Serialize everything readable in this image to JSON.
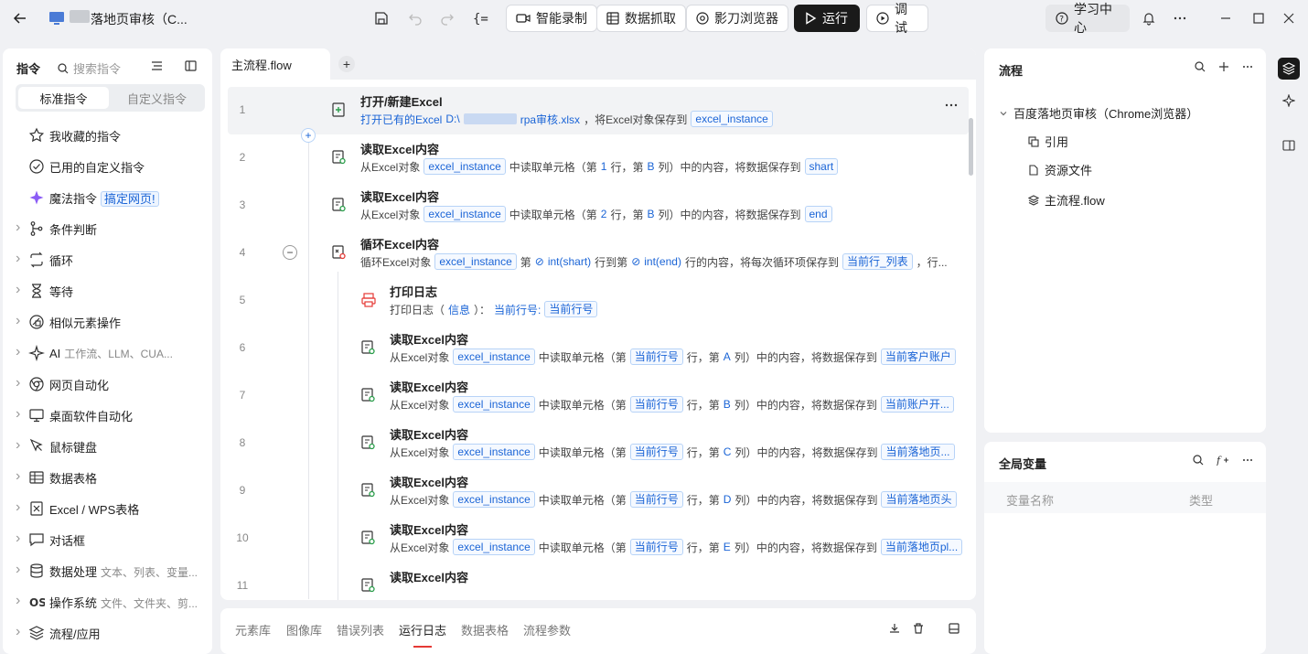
{
  "app": {
    "title": "落地页审核（C...",
    "toolbar": {
      "record": "智能录制",
      "grab": "数据抓取",
      "browser": "影刀浏览器",
      "run": "运行",
      "debug": "调试",
      "learn": "学习中心"
    }
  },
  "left_panel": {
    "title": "指令",
    "search_placeholder": "搜索指令",
    "tabs": [
      "标准指令",
      "自定义指令"
    ],
    "items": [
      {
        "label": "我收藏的指令",
        "icon": "star-icon"
      },
      {
        "label": "已用的自定义指令",
        "icon": "check-circle-icon"
      },
      {
        "label": "魔法指令",
        "icon": "sparkle-icon",
        "tag": "搞定网页!"
      },
      {
        "label": "条件判断",
        "icon": "branch-icon"
      },
      {
        "label": "循环",
        "icon": "loop-icon"
      },
      {
        "label": "等待",
        "icon": "hourglass-icon"
      },
      {
        "label": "相似元素操作",
        "icon": "similar-icon"
      },
      {
        "label": "AI",
        "sub": "工作流、LLM、CUA...",
        "icon": "ai-icon"
      },
      {
        "label": "网页自动化",
        "icon": "chrome-icon"
      },
      {
        "label": "桌面软件自动化",
        "icon": "monitor-icon"
      },
      {
        "label": "鼠标键盘",
        "icon": "cursor-icon"
      },
      {
        "label": "数据表格",
        "icon": "table-icon"
      },
      {
        "label": "Excel / WPS表格",
        "icon": "excel-icon"
      },
      {
        "label": "对话框",
        "icon": "dialog-icon"
      },
      {
        "label": "数据处理",
        "sub": "文本、列表、变量...",
        "icon": "database-icon"
      },
      {
        "label": "操作系统",
        "sub": "文件、文件夹、剪...",
        "icon": "os-icon"
      },
      {
        "label": "流程/应用",
        "icon": "layers-icon"
      }
    ]
  },
  "editor": {
    "tab": "主流程.flow",
    "steps": [
      {
        "n": "1",
        "title": "打开/新建Excel",
        "p1": "打开已有的Excel",
        "p2": "D:\\",
        "p3": "rpa审核.xlsx",
        "p4": "，将Excel对象保存到",
        "v1": "excel_instance"
      },
      {
        "n": "2",
        "title": "读取Excel内容",
        "a": "从Excel对象",
        "v1": "excel_instance",
        "b": "中读取单元格（第",
        "r": "1",
        "c": "行，第",
        "col": "B",
        "d": "列）中的内容，将数据保存到",
        "v2": "shart"
      },
      {
        "n": "3",
        "title": "读取Excel内容",
        "a": "从Excel对象",
        "v1": "excel_instance",
        "b": "中读取单元格（第",
        "r": "2",
        "c": "行，第",
        "col": "B",
        "d": "列）中的内容，将数据保存到",
        "v2": "end"
      },
      {
        "n": "4",
        "title": "循环Excel内容",
        "a": "循环Excel对象",
        "v1": "excel_instance",
        "b": "第",
        "e1": "int(shart)",
        "c": "行到第",
        "e2": "int(end)",
        "d": "行的内容，将每次循环项保存到",
        "v2": "当前行_列表",
        "e": "，行..."
      },
      {
        "n": "5",
        "title": "打印日志",
        "a": "打印日志（",
        "info": "信息",
        "b": "）：",
        "lbl": "当前行号:",
        "v1": "当前行号"
      },
      {
        "n": "6",
        "title": "读取Excel内容",
        "a": "从Excel对象",
        "v1": "excel_instance",
        "b": "中读取单元格（第",
        "v3": "当前行号",
        "c": "行，第",
        "col": "A",
        "d": "列）中的内容，将数据保存到",
        "v2": "当前客户账户"
      },
      {
        "n": "7",
        "title": "读取Excel内容",
        "a": "从Excel对象",
        "v1": "excel_instance",
        "b": "中读取单元格（第",
        "v3": "当前行号",
        "c": "行，第",
        "col": "B",
        "d": "列）中的内容，将数据保存到",
        "v2": "当前账户开..."
      },
      {
        "n": "8",
        "title": "读取Excel内容",
        "a": "从Excel对象",
        "v1": "excel_instance",
        "b": "中读取单元格（第",
        "v3": "当前行号",
        "c": "行，第",
        "col": "C",
        "d": "列）中的内容，将数据保存到",
        "v2": "当前落地页..."
      },
      {
        "n": "9",
        "title": "读取Excel内容",
        "a": "从Excel对象",
        "v1": "excel_instance",
        "b": "中读取单元格（第",
        "v3": "当前行号",
        "c": "行，第",
        "col": "D",
        "d": "列）中的内容，将数据保存到",
        "v2": "当前落地页头"
      },
      {
        "n": "10",
        "title": "读取Excel内容",
        "a": "从Excel对象",
        "v1": "excel_instance",
        "b": "中读取单元格（第",
        "v3": "当前行号",
        "c": "行，第",
        "col": "E",
        "d": "列）中的内容，将数据保存到",
        "v2": "当前落地页pl..."
      },
      {
        "n": "11",
        "title": "读取Excel内容"
      }
    ]
  },
  "bottom_tabs": [
    "元素库",
    "图像库",
    "错误列表",
    "运行日志",
    "数据表格",
    "流程参数"
  ],
  "flow_panel": {
    "title": "流程",
    "root": "百度落地页审核（Chrome浏览器）",
    "children": [
      "引用",
      "资源文件",
      "主流程.flow"
    ]
  },
  "var_panel": {
    "title": "全局变量",
    "col_name": "变量名称",
    "col_type": "类型"
  }
}
